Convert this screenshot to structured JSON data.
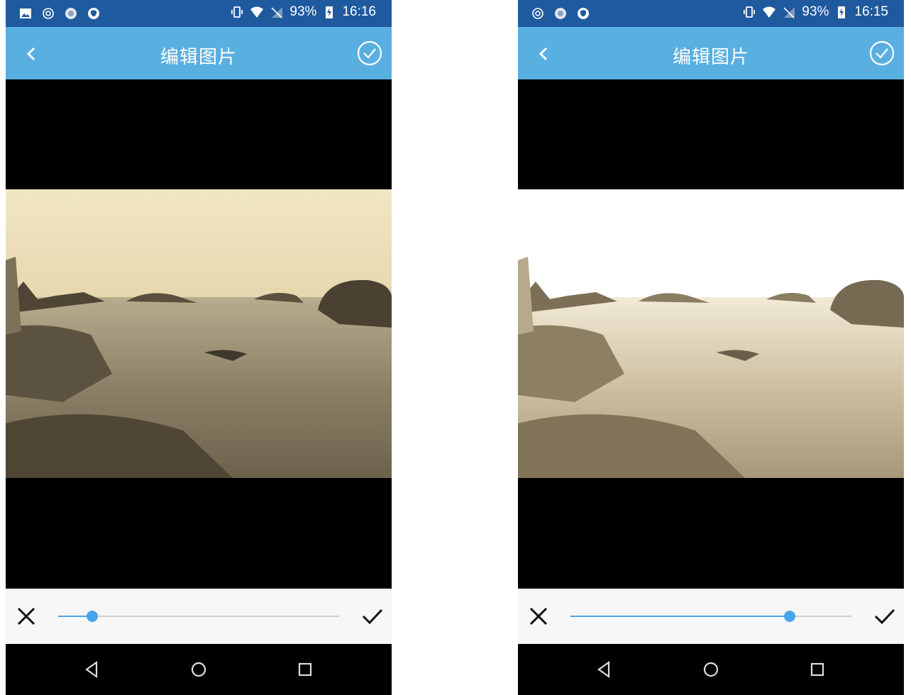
{
  "screens": [
    {
      "status": {
        "battery": "93%",
        "time": "16:16",
        "notification_icons": [
          "image-icon",
          "spiral-icon",
          "sunflower-icon",
          "shield-icon"
        ]
      },
      "title": "编辑图片",
      "adjustment_level": 0.12,
      "photo_tone": "sepia"
    },
    {
      "status": {
        "battery": "93%",
        "time": "16:15",
        "notification_icons": [
          "spiral-icon",
          "sunflower-icon",
          "shield-icon"
        ]
      },
      "title": "编辑图片",
      "adjustment_level": 0.78,
      "photo_tone": "sepia-bright"
    }
  ],
  "colors": {
    "status_bar": "#1f5a9f",
    "app_bar": "#5aafe1",
    "accent": "#4aa6ec",
    "adjust_bar": "#f7f7f7"
  }
}
